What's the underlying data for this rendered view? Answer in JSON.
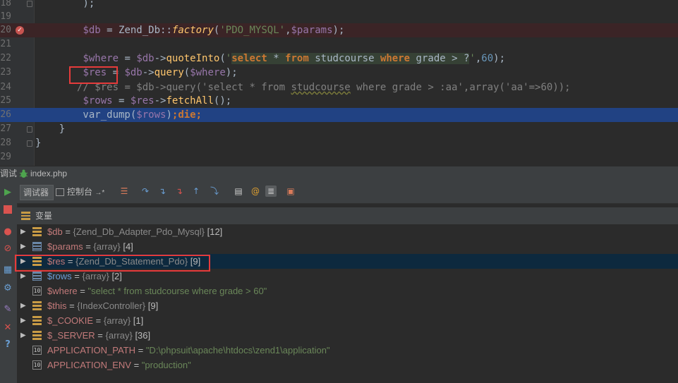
{
  "editor": {
    "lines": [
      {
        "num": "18",
        "html": "        );"
      },
      {
        "num": "19",
        "html": ""
      },
      {
        "num": "20",
        "html": "        <span class=\"v\">$db</span> = Zend_Db::<span class=\"it\">factory</span>(<span class=\"s\">'PDO_MYSQL'</span>,<span class=\"v\">$params</span>);"
      },
      {
        "num": "21",
        "html": ""
      },
      {
        "num": "22",
        "html": "        <span class=\"v\">$where</span> = <span class=\"v\">$db</span>-&gt;<span class=\"f\">quoteInto</span>(<span class=\"s\">'</span><span class=\"sqlbg\"><span class=\"kw\">select</span> * <span class=\"kw\">from</span> studcourse <span class=\"kw\">where</span> grade &gt; ?</span><span class=\"s\">'</span>,<span class=\"n\">60</span>);"
      },
      {
        "num": "23",
        "html": "        <span class=\"v\">$res</span> = <span class=\"v\">$db</span>-&gt;<span class=\"f\">query</span>(<span class=\"v\">$where</span>);"
      },
      {
        "num": "24",
        "html": "       <span class=\"cm\">// $res = $db-&gt;query('select * from <span class=\"wavy\">studcourse</span> where grade &gt; :aa',array('aa'=&gt;60));</span>"
      },
      {
        "num": "25",
        "html": "        <span class=\"v\">$rows</span> = <span class=\"v\">$res</span>-&gt;<span class=\"f\">fetchAll</span>();"
      },
      {
        "num": "26",
        "html": "        var_dump(<span class=\"v\">$rows</span>)<span class=\"k\">;die;</span>"
      },
      {
        "num": "27",
        "html": "    }"
      },
      {
        "num": "28",
        "html": "}"
      },
      {
        "num": "29",
        "html": ""
      }
    ]
  },
  "debug_tab": {
    "prefix": "调试",
    "file": "index.php"
  },
  "subtabs": {
    "debugger": "调试器",
    "console": "控制台",
    "console_arrow": "→*"
  },
  "variables_header": "变量",
  "variables": [
    {
      "name": "$db",
      "eq": " = ",
      "type": "{Zend_Db_Adapter_Pdo_Mysql}",
      "count": " [12]",
      "kind": "obj",
      "expand": true,
      "value": ""
    },
    {
      "name": "$params",
      "eq": " = ",
      "type": "{array}",
      "count": " [4]",
      "kind": "arr",
      "expand": true,
      "value": ""
    },
    {
      "name": "$res",
      "eq": " = ",
      "type": "{Zend_Db_Statement_Pdo}",
      "count": " [9]",
      "kind": "obj",
      "expand": true,
      "value": "",
      "selected": true
    },
    {
      "name": "$rows",
      "eq": " = ",
      "type": "{array}",
      "count": " [2]",
      "kind": "arr",
      "expand": true,
      "value": "",
      "blue": true
    },
    {
      "name": "$where",
      "eq": " = ",
      "type": "",
      "count": "",
      "kind": "str",
      "expand": false,
      "value": "\"select * from studcourse where grade > 60\""
    },
    {
      "name": "$this",
      "eq": " = ",
      "type": "{IndexController}",
      "count": " [9]",
      "kind": "obj",
      "expand": true,
      "value": ""
    },
    {
      "name": "$_COOKIE",
      "eq": " = ",
      "type": "{array}",
      "count": " [1]",
      "kind": "obj",
      "expand": true,
      "value": ""
    },
    {
      "name": "$_SERVER",
      "eq": " = ",
      "type": "{array}",
      "count": " [36]",
      "kind": "obj",
      "expand": true,
      "value": ""
    },
    {
      "name": "APPLICATION_PATH",
      "eq": " = ",
      "type": "",
      "count": "",
      "kind": "str",
      "expand": false,
      "value": "\"D:\\phpsuit\\apache\\htdocs\\zend1\\application\""
    },
    {
      "name": "APPLICATION_ENV",
      "eq": " = ",
      "type": "",
      "count": "",
      "kind": "str",
      "expand": false,
      "value": "\"production\""
    }
  ]
}
